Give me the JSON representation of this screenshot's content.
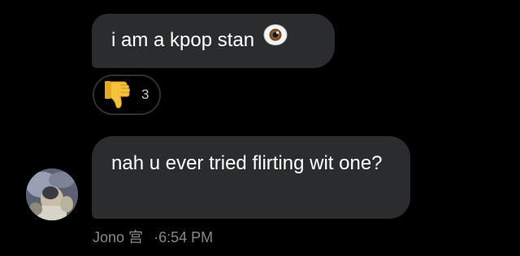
{
  "messages": [
    {
      "text": "i am a kpop stan",
      "emoji_icon": "eye-icon",
      "reaction": {
        "icon": "thumbs-down-icon",
        "count": "3"
      }
    },
    {
      "text": "nah u ever tried flirting wit one?"
    }
  ],
  "sender": {
    "name": "Jono 宫",
    "separator": "·",
    "time": "6:54 PM",
    "avatar_icon": "avatar-photo"
  },
  "colors": {
    "background": "#000000",
    "bubble": "#2b2c2e",
    "text": "#ffffff",
    "meta_text": "#86878b",
    "reaction_border": "#2e2f31"
  }
}
